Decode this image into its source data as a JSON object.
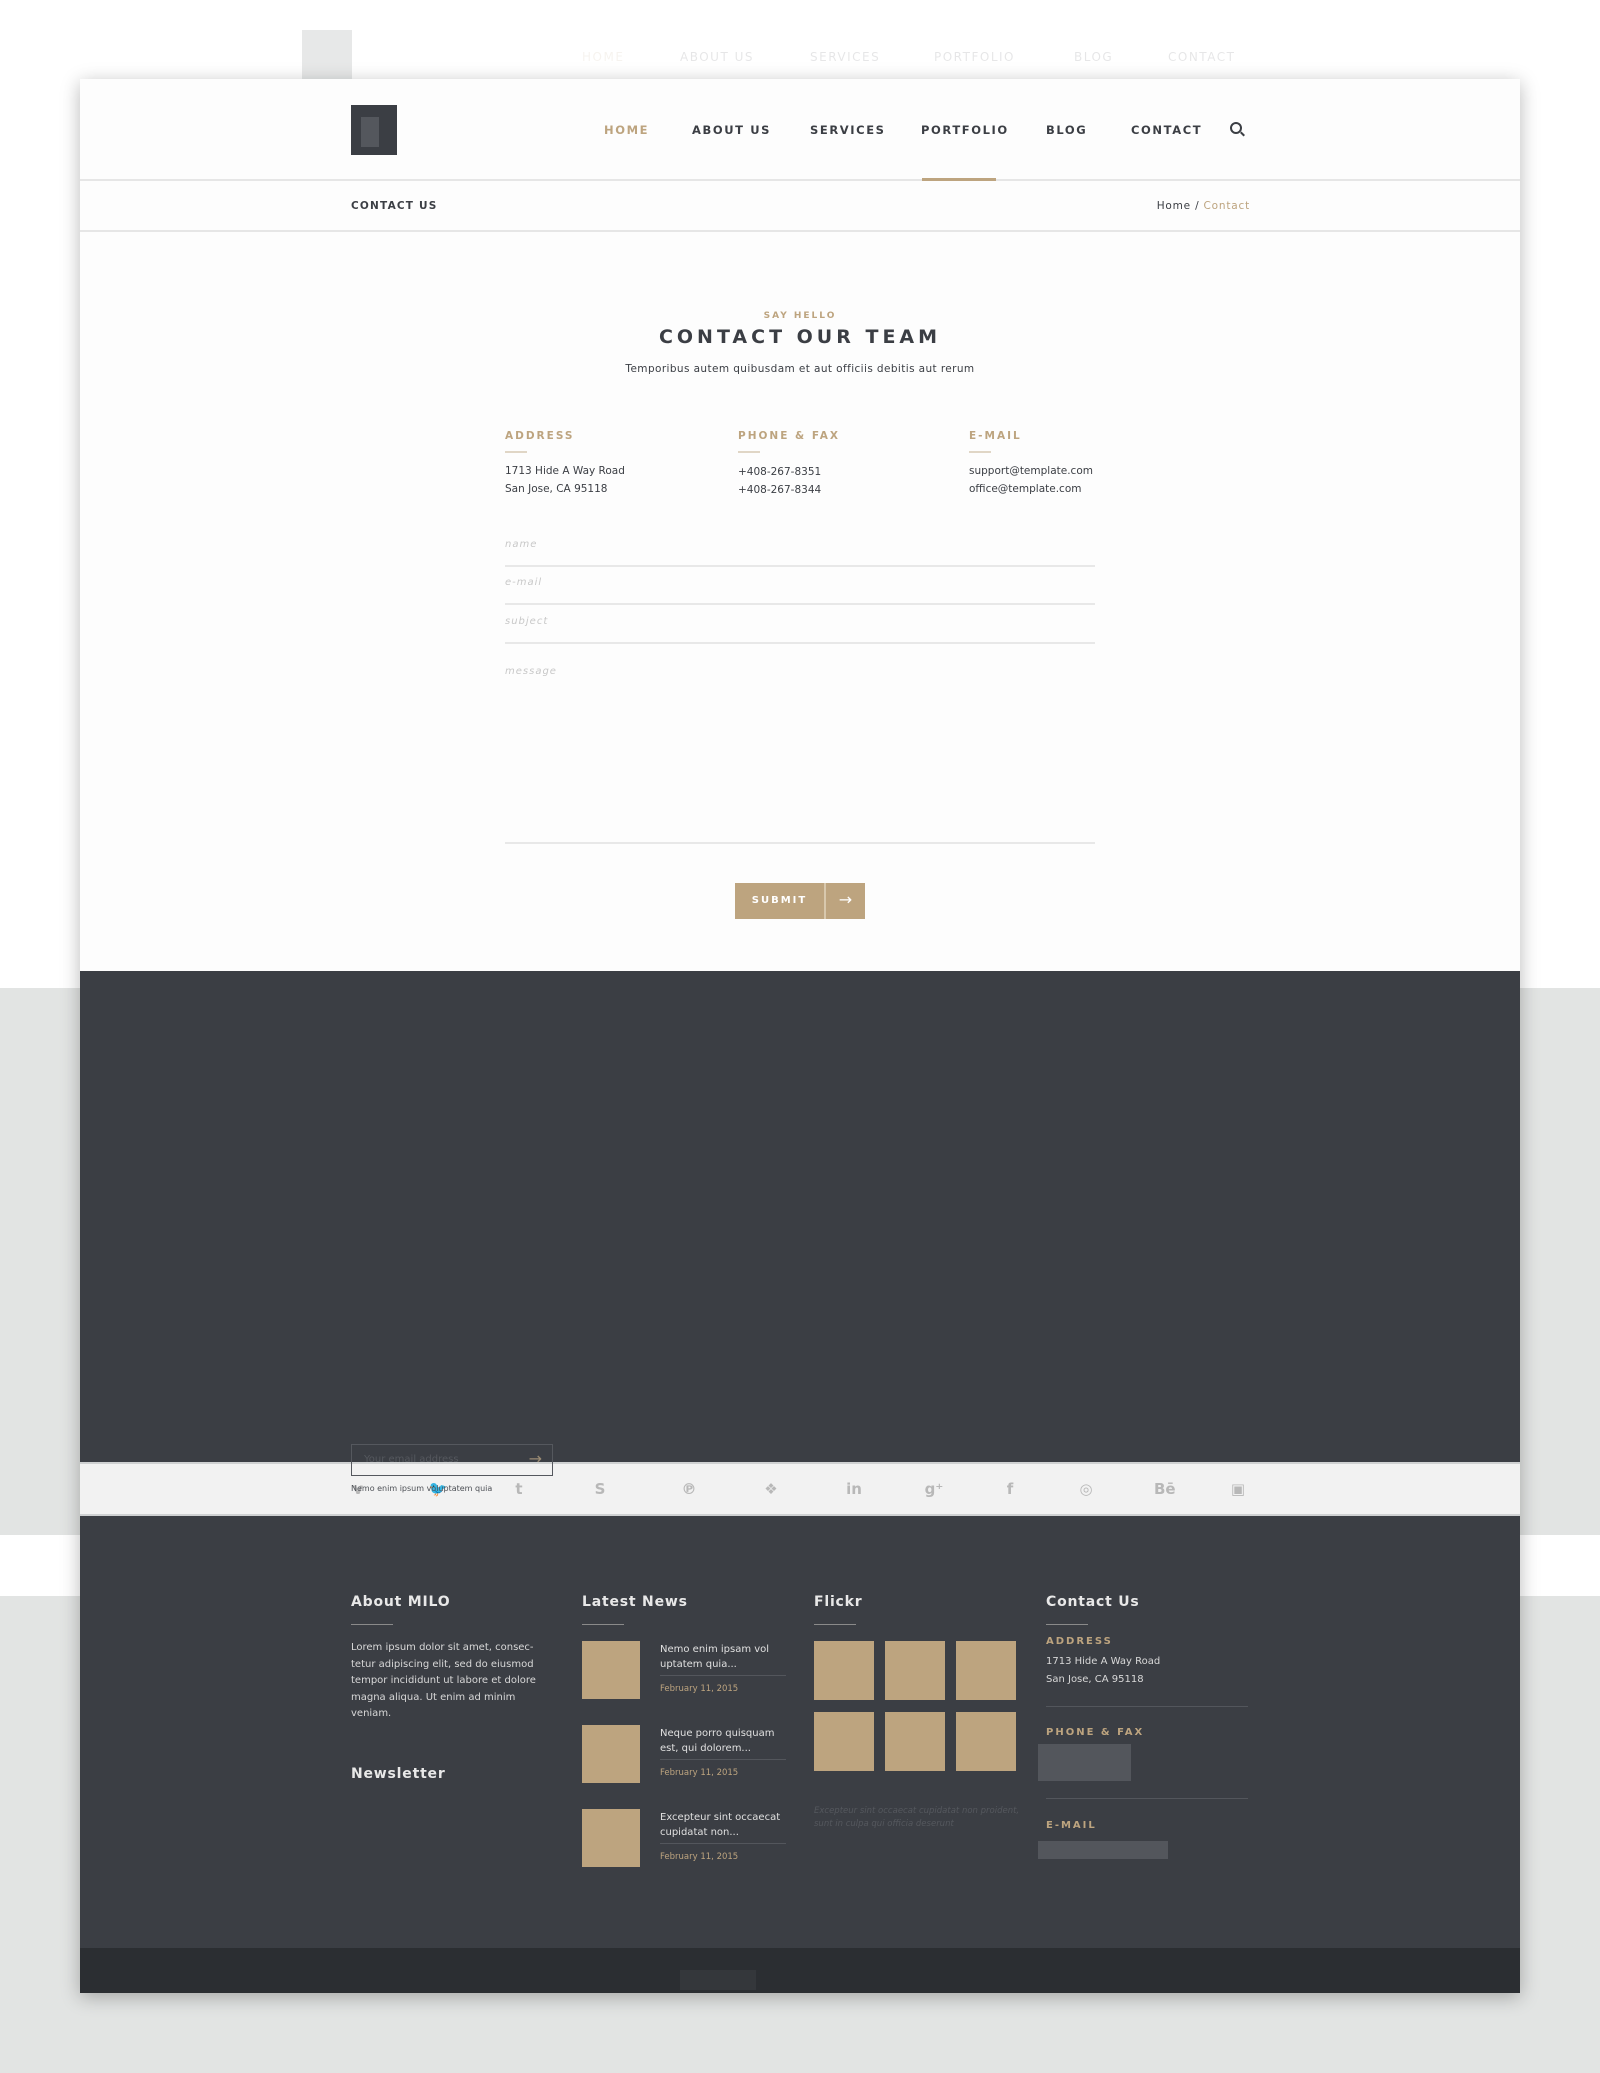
{
  "nav": {
    "items": [
      "HOME",
      "ABOUT US",
      "SERVICES",
      "PORTFOLIO",
      "BLOG",
      "CONTACT"
    ],
    "active": "HOME",
    "hover": "PORTFOLIO",
    "search_icon": "search-icon"
  },
  "subheader": {
    "title": "CONTACT US",
    "breadcrumb": {
      "home": "Home",
      "sep": "/",
      "current": "Contact"
    }
  },
  "intro": {
    "kicker": "SAY HELLO",
    "title": "CONTACT OUR TEAM",
    "subtitle": "Temporibus autem quibusdam et aut officiis debitis aut rerum"
  },
  "info": {
    "address": {
      "label": "ADDRESS",
      "lines": [
        "1713 Hide A Way Road",
        "San Jose, CA 95118"
      ]
    },
    "phone": {
      "label": "PHONE & FAX",
      "lines": [
        "+408-267-8351",
        "+408-267-8344"
      ]
    },
    "email": {
      "label": "E-MAIL",
      "lines": [
        "support@template.com",
        "office@template.com"
      ]
    }
  },
  "form": {
    "name_placeholder": "name",
    "email_placeholder": "e-mail",
    "subject_placeholder": "subject",
    "message_placeholder": "message",
    "submit_label": "SUBMIT"
  },
  "social": [
    "vimeo",
    "twitter",
    "tumblr",
    "skype",
    "pinterest",
    "dropbox",
    "linkedin",
    "google-plus",
    "facebook",
    "instagram",
    "behance",
    "youtube"
  ],
  "social_glyphs": [
    "v",
    "🐦",
    "t",
    "S",
    "℗",
    "❖",
    "in",
    "g⁺",
    "f",
    "◎",
    "Bē",
    "▣"
  ],
  "footer": {
    "about": {
      "heading": "About MILO",
      "text": "Lorem ipsum dolor sit amet, consec-tetur adipiscing elit, sed do eiusmod tempor incididunt ut labore et dolore magna aliqua. Ut enim ad minim veniam."
    },
    "newsletter": {
      "heading": "Newsletter",
      "placeholder": "Your email address",
      "note": "Nemo enim ipsum voluptatem quia"
    },
    "news": {
      "heading": "Latest News",
      "items": [
        {
          "title": "Nemo enim ipsam vol uptatem quia...",
          "date": "February 11, 2015"
        },
        {
          "title": "Neque porro quisquam est, qui dolorem...",
          "date": "February 11, 2015"
        },
        {
          "title": "Excepteur sint occaecat cupidatat non...",
          "date": "February 11, 2015"
        }
      ]
    },
    "flickr": {
      "heading": "Flickr",
      "caption": "Excepteur sint occaecat cupidatat non proident, sunt in culpa qui officia deserunt"
    },
    "contact": {
      "heading": "Contact Us",
      "address_label": "ADDRESS",
      "address_lines": [
        "1713 Hide A Way Road",
        "San Jose, CA 95118"
      ],
      "phone_label": "PHONE & FAX",
      "email_label": "E-MAIL"
    }
  },
  "colors": {
    "accent": "#bda47f",
    "dark": "#3b3e44",
    "bottom": "#2b2e32"
  }
}
